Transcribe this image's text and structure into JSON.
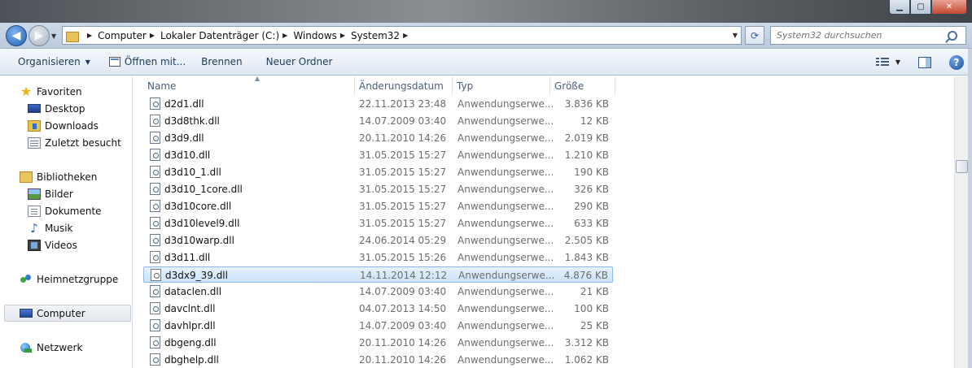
{
  "window": {
    "controls": {
      "minimize": "▁",
      "maximize": "▢",
      "close": "✕"
    }
  },
  "address": {
    "breadcrumbs": [
      "Computer",
      "Lokaler Datenträger (C:)",
      "Windows",
      "System32"
    ],
    "search_placeholder": "System32 durchsuchen"
  },
  "toolbar": {
    "organize": "Organisieren",
    "open_with": "Öffnen mit...",
    "burn": "Brennen",
    "new_folder": "Neuer Ordner",
    "help": "?"
  },
  "sidebar": {
    "favorites": "Favoriten",
    "desktop": "Desktop",
    "downloads": "Downloads",
    "recent": "Zuletzt besucht",
    "libraries": "Bibliotheken",
    "pictures": "Bilder",
    "documents": "Dokumente",
    "music": "Musik",
    "videos": "Videos",
    "homegroup": "Heimnetzgruppe",
    "computer": "Computer",
    "network": "Netzwerk"
  },
  "columns": {
    "name": "Name",
    "date": "Änderungsdatum",
    "type": "Typ",
    "size": "Größe"
  },
  "files": [
    {
      "name": "d2d1.dll",
      "date": "22.11.2013 23:48",
      "type": "Anwendungserwe...",
      "size": "3.836 KB"
    },
    {
      "name": "d3d8thk.dll",
      "date": "14.07.2009 03:40",
      "type": "Anwendungserwe...",
      "size": "12 KB"
    },
    {
      "name": "d3d9.dll",
      "date": "20.11.2010 14:26",
      "type": "Anwendungserwe...",
      "size": "2.019 KB"
    },
    {
      "name": "d3d10.dll",
      "date": "31.05.2015 15:27",
      "type": "Anwendungserwe...",
      "size": "1.210 KB"
    },
    {
      "name": "d3d10_1.dll",
      "date": "31.05.2015 15:27",
      "type": "Anwendungserwe...",
      "size": "190 KB"
    },
    {
      "name": "d3d10_1core.dll",
      "date": "31.05.2015 15:27",
      "type": "Anwendungserwe...",
      "size": "326 KB"
    },
    {
      "name": "d3d10core.dll",
      "date": "31.05.2015 15:27",
      "type": "Anwendungserwe...",
      "size": "290 KB"
    },
    {
      "name": "d3d10level9.dll",
      "date": "31.05.2015 15:27",
      "type": "Anwendungserwe...",
      "size": "633 KB"
    },
    {
      "name": "d3d10warp.dll",
      "date": "24.06.2014 05:29",
      "type": "Anwendungserwe...",
      "size": "2.505 KB"
    },
    {
      "name": "d3d11.dll",
      "date": "31.05.2015 15:26",
      "type": "Anwendungserwe...",
      "size": "1.843 KB"
    },
    {
      "name": "d3dx9_39.dll",
      "date": "14.11.2014 12:12",
      "type": "Anwendungserwe...",
      "size": "4.876 KB",
      "selected": true
    },
    {
      "name": "dataclen.dll",
      "date": "14.07.2009 03:40",
      "type": "Anwendungserwe...",
      "size": "21 KB"
    },
    {
      "name": "davclnt.dll",
      "date": "04.07.2013 14:50",
      "type": "Anwendungserwe...",
      "size": "100 KB"
    },
    {
      "name": "davhlpr.dll",
      "date": "14.07.2009 03:40",
      "type": "Anwendungserwe...",
      "size": "25 KB"
    },
    {
      "name": "dbgeng.dll",
      "date": "20.11.2010 14:26",
      "type": "Anwendungserwe...",
      "size": "3.312 KB"
    },
    {
      "name": "dbghelp.dll",
      "date": "20.11.2010 14:26",
      "type": "Anwendungserwe...",
      "size": "1.062 KB"
    }
  ],
  "colors": {
    "accent": "#1e395b",
    "selection": "#cce2f9",
    "selection_border": "#8db8e8"
  }
}
